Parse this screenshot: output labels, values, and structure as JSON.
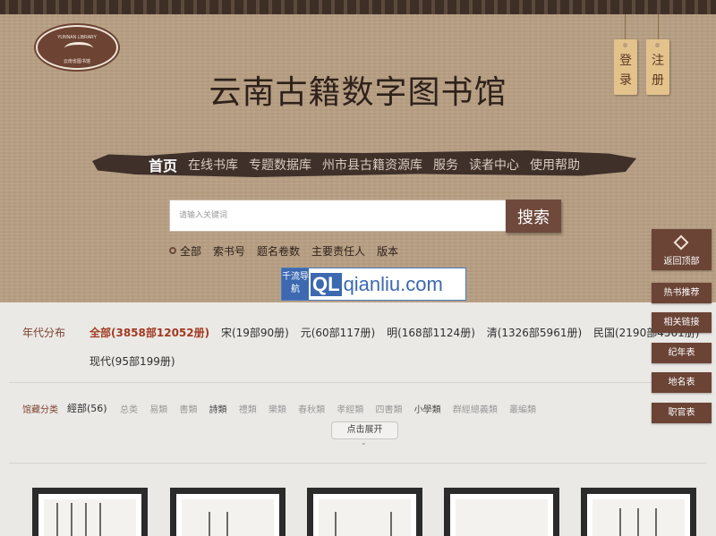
{
  "header": {
    "logo_top_text": "YUNNAN LIBRARY",
    "logo_bottom_text": "云南省图书馆",
    "site_title": "云南古籍数字图书馆",
    "login_label": "登\n录",
    "register_label": "注\n册"
  },
  "nav": {
    "items": [
      {
        "label": "首页",
        "active": true
      },
      {
        "label": "在线书库"
      },
      {
        "label": "专题数据库"
      },
      {
        "label": "州市县古籍资源库"
      },
      {
        "label": "服务"
      },
      {
        "label": "读者中心"
      },
      {
        "label": "使用帮助"
      }
    ]
  },
  "search": {
    "placeholder": "请输入关键词",
    "button_label": "搜索",
    "options": [
      "全部",
      "索书号",
      "题名卷数",
      "主要责任人",
      "版本"
    ]
  },
  "ad": {
    "left_text": "千流导航",
    "ql": "QL",
    "domain": "qianliu.com"
  },
  "filters": {
    "year_label": "年代分布",
    "years": [
      "全部(3858部12052册)",
      "宋(19部90册)",
      "元(60部117册)",
      "明(168部1124册)",
      "清(1326部5961册)",
      "民国(2190部4561册)"
    ],
    "years_line2": "现代(95部199册)",
    "category_label": "馆藏分类",
    "category_first": "經部(56)",
    "categories": [
      {
        "label": "总类",
        "dark": false
      },
      {
        "label": "易類",
        "dark": false
      },
      {
        "label": "書類",
        "dark": false
      },
      {
        "label": "詩類",
        "dark": true
      },
      {
        "label": "禮類",
        "dark": false
      },
      {
        "label": "樂類",
        "dark": false
      },
      {
        "label": "春秋類",
        "dark": false
      },
      {
        "label": "孝經類",
        "dark": false
      },
      {
        "label": "四書類",
        "dark": false
      },
      {
        "label": "小學類",
        "dark": true
      },
      {
        "label": "群經總義類",
        "dark": false
      },
      {
        "label": "叢編類",
        "dark": false
      }
    ],
    "expand_label": "点击展开"
  },
  "float_menu": {
    "back_to_top": "返回顶部",
    "items": [
      "热书推荐",
      "相关链接",
      "纪年表",
      "地名表",
      "职官表"
    ]
  },
  "colors": {
    "brand_brown": "#6b4436",
    "header_bg": "#b79e82",
    "accent_red": "#a03b22"
  }
}
